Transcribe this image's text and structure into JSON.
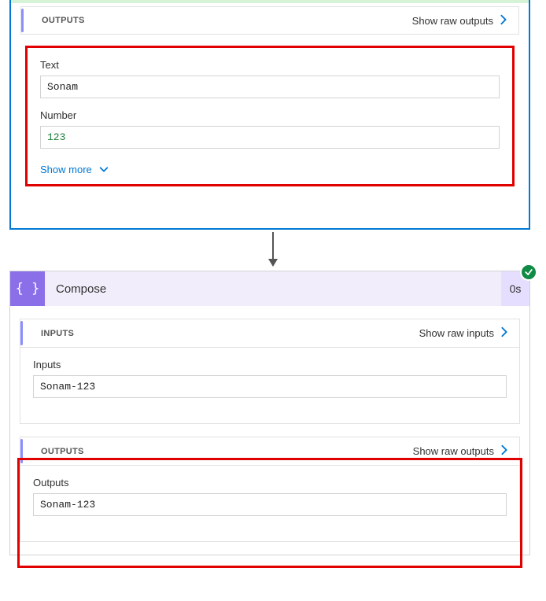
{
  "topCard": {
    "outputs_header": "OUTPUTS",
    "show_raw_outputs": "Show raw outputs",
    "fields": {
      "text_label": "Text",
      "text_value": "Sonam",
      "number_label": "Number",
      "number_value": "123"
    },
    "show_more": "Show more"
  },
  "compose": {
    "title": "Compose",
    "duration": "0s",
    "status": "success",
    "inputs_header": "INPUTS",
    "show_raw_inputs": "Show raw inputs",
    "inputs_label": "Inputs",
    "inputs_value": "Sonam-123",
    "outputs_header": "OUTPUTS",
    "show_raw_outputs": "Show raw outputs",
    "outputs_label": "Outputs",
    "outputs_value": "Sonam-123"
  }
}
